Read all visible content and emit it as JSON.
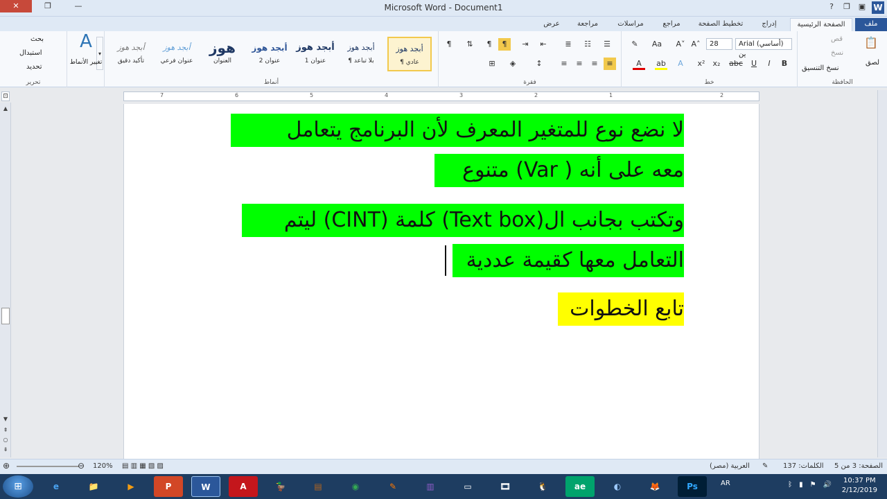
{
  "window": {
    "title": "Microsoft Word - Document1",
    "close": "✕",
    "maximize": "❐",
    "minimize": "—"
  },
  "qat": {
    "help": "?",
    "restore": "❐",
    "minimize": "_",
    "word": "W"
  },
  "tabs": {
    "file": "ملف",
    "home": "الصفحة الرئيسية",
    "insert": "إدراج",
    "layout": "تخطيط الصفحة",
    "references": "مراجع",
    "mailings": "مراسلات",
    "review": "مراجعة",
    "view": "عرض"
  },
  "ribbon": {
    "clipboard": {
      "paste": "لصق",
      "cut": "قص",
      "copy": "نسخ",
      "format_painter": "نسخ التنسيق",
      "group": "الحافظة"
    },
    "font": {
      "name": "Arial (أساسي) ين",
      "size": "28",
      "group": "خط",
      "bold": "B",
      "italic": "I",
      "underline": "U",
      "strike": "abc",
      "sub": "x₂",
      "sup": "x²"
    },
    "paragraph": {
      "group": "فقرة",
      "pilcrow": "¶"
    },
    "styles": {
      "group": "أنماط",
      "items": [
        {
          "preview": "أبجد هوز",
          "name": "¶ عادي"
        },
        {
          "preview": "أبجد هوز",
          "name": "¶ بلا تباعد"
        },
        {
          "preview": "أبجد هوز",
          "name": "عنوان 1"
        },
        {
          "preview": "أبجد هوز",
          "name": "عنوان 2"
        },
        {
          "preview": "هوز",
          "name": "العنوان"
        },
        {
          "preview": "أبجد هوز",
          "name": "عنوان فرعي"
        },
        {
          "preview": "أبجد هوز",
          "name": "تأكيد دقيق"
        }
      ],
      "change": "تغيير الأنماط"
    },
    "editing": {
      "group": "تحرير",
      "find": "بحث",
      "replace": "استبدال",
      "select": "تحديد"
    }
  },
  "ruler": {
    "marks": [
      "7",
      "6",
      "5",
      "4",
      "3",
      "2",
      "1",
      "1",
      "2"
    ]
  },
  "document": {
    "lines": [
      {
        "text": "لا نضع نوع للمتغير المعرف لأن البرنامج يتعامل",
        "highlight": "#00ff00"
      },
      {
        "text": "معه على أنه ( Var) متنوع",
        "highlight": "#00ff00"
      },
      {
        "text": "وتكتب بجانب ال(Text box) كلمة (CINT) ليتم",
        "highlight": "#00ff00"
      },
      {
        "text": "التعامل معها كقيمة عددية",
        "highlight": "#00ff00"
      },
      {
        "text": "تابع الخطوات",
        "highlight": "#ffff00"
      }
    ]
  },
  "status": {
    "page": "الصفحة: 3 من 5",
    "words": "الكلمات: 137",
    "language": "العربية (مصر)",
    "zoom": "120%"
  },
  "taskbar": {
    "apps": [
      "e",
      "📁",
      "▶",
      "P",
      "W",
      "A",
      "🦆",
      "▤",
      "◉",
      "✎",
      "▥",
      "▭",
      "🎞",
      "🐧",
      "ae",
      "◐",
      "🦊",
      "Ps"
    ],
    "language": "AR",
    "time": "10:37 PM",
    "date": "2/12/2019"
  }
}
